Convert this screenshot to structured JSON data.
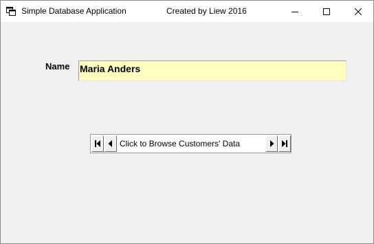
{
  "window": {
    "title": "Simple Database Application",
    "credit": "Created by Liew 2016",
    "icon": "app-window-icon",
    "controls": [
      "minimize-icon",
      "maximize-icon",
      "close-icon"
    ]
  },
  "form": {
    "name_label": "Name",
    "name_value": "Maria Anders",
    "field_background": "#ffffc0"
  },
  "data_control": {
    "caption": "Click to Browse Customers' Data",
    "buttons": [
      "first-record-icon",
      "previous-record-icon",
      "next-record-icon",
      "last-record-icon"
    ]
  }
}
